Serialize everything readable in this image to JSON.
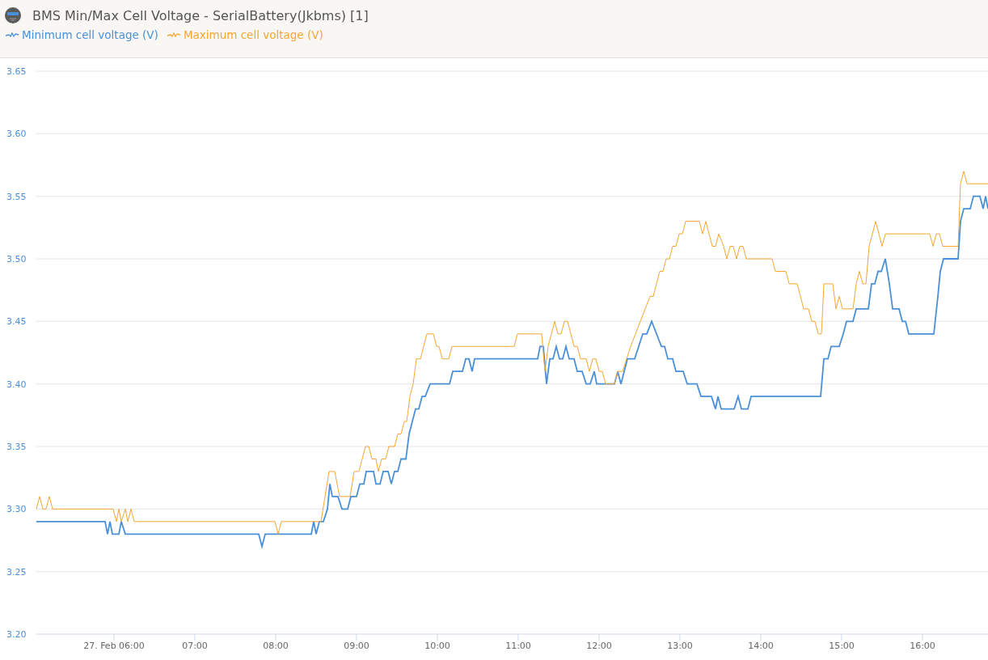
{
  "header": {
    "title": "BMS Min/Max Cell Voltage - SerialBattery(Jkbms) [1]"
  },
  "chart_data": {
    "type": "line",
    "grid": true,
    "xlim": [
      5.04,
      16.81
    ],
    "ylim": [
      3.2,
      3.65
    ],
    "xticks": [
      {
        "value": 6,
        "label": "27. Feb 06:00"
      },
      {
        "value": 7,
        "label": "07:00"
      },
      {
        "value": 8,
        "label": "08:00"
      },
      {
        "value": 9,
        "label": "09:00"
      },
      {
        "value": 10,
        "label": "10:00"
      },
      {
        "value": 11,
        "label": "11:00"
      },
      {
        "value": 12,
        "label": "12:00"
      },
      {
        "value": 13,
        "label": "13:00"
      },
      {
        "value": 14,
        "label": "14:00"
      },
      {
        "value": 15,
        "label": "15:00"
      },
      {
        "value": 16,
        "label": "16:00"
      }
    ],
    "yticks": [
      {
        "value": 3.2,
        "label": "3.20"
      },
      {
        "value": 3.25,
        "label": "3.25"
      },
      {
        "value": 3.3,
        "label": "3.30"
      },
      {
        "value": 3.35,
        "label": "3.35"
      },
      {
        "value": 3.4,
        "label": "3.40"
      },
      {
        "value": 3.45,
        "label": "3.45"
      },
      {
        "value": 3.5,
        "label": "3.50"
      },
      {
        "value": 3.55,
        "label": "3.55"
      },
      {
        "value": 3.6,
        "label": "3.60"
      },
      {
        "value": 3.65,
        "label": "3.65"
      }
    ],
    "series": [
      {
        "name": "Minimum cell voltage (V)",
        "color": "#4a90d9",
        "x": [
          5.04,
          5.89,
          5.92,
          5.95,
          5.98,
          6.06,
          6.09,
          6.14,
          7.79,
          7.83,
          7.87,
          8.44,
          8.47,
          8.5,
          8.54,
          8.59,
          8.64,
          8.67,
          8.7,
          8.77,
          8.82,
          8.89,
          8.93,
          9.0,
          9.04,
          9.09,
          9.12,
          9.21,
          9.24,
          9.29,
          9.33,
          9.39,
          9.43,
          9.47,
          9.51,
          9.55,
          9.61,
          9.65,
          9.69,
          9.73,
          9.77,
          9.81,
          9.85,
          9.91,
          10.15,
          10.19,
          10.31,
          10.35,
          10.39,
          10.43,
          10.46,
          11.24,
          11.27,
          11.31,
          11.35,
          11.39,
          11.43,
          11.47,
          11.51,
          11.55,
          11.59,
          11.63,
          11.69,
          11.73,
          11.79,
          11.84,
          11.89,
          11.94,
          11.97,
          12.19,
          12.23,
          12.27,
          12.31,
          12.35,
          12.44,
          12.49,
          12.54,
          12.59,
          12.65,
          12.71,
          12.77,
          12.81,
          12.85,
          12.91,
          12.95,
          13.04,
          13.09,
          13.21,
          13.26,
          13.39,
          13.44,
          13.47,
          13.51,
          13.67,
          13.72,
          13.76,
          13.84,
          13.88,
          14.74,
          14.78,
          14.83,
          14.87,
          14.97,
          15.02,
          15.06,
          15.14,
          15.18,
          15.33,
          15.37,
          15.41,
          15.45,
          15.49,
          15.54,
          15.59,
          15.63,
          15.71,
          15.75,
          15.79,
          15.83,
          16.14,
          16.19,
          16.22,
          16.26,
          16.44,
          16.47,
          16.51,
          16.59,
          16.63,
          16.71,
          16.75,
          16.78,
          16.81
        ],
        "values": [
          3.29,
          3.29,
          3.28,
          3.29,
          3.28,
          3.28,
          3.29,
          3.28,
          3.28,
          3.27,
          3.28,
          3.28,
          3.29,
          3.28,
          3.29,
          3.29,
          3.3,
          3.32,
          3.31,
          3.31,
          3.3,
          3.3,
          3.31,
          3.31,
          3.32,
          3.32,
          3.33,
          3.33,
          3.32,
          3.32,
          3.33,
          3.33,
          3.32,
          3.33,
          3.33,
          3.34,
          3.34,
          3.36,
          3.37,
          3.38,
          3.38,
          3.39,
          3.39,
          3.4,
          3.4,
          3.41,
          3.41,
          3.42,
          3.42,
          3.41,
          3.42,
          3.42,
          3.43,
          3.43,
          3.4,
          3.42,
          3.42,
          3.43,
          3.42,
          3.42,
          3.43,
          3.42,
          3.42,
          3.41,
          3.41,
          3.4,
          3.4,
          3.41,
          3.4,
          3.4,
          3.41,
          3.4,
          3.41,
          3.42,
          3.42,
          3.43,
          3.44,
          3.44,
          3.45,
          3.44,
          3.43,
          3.43,
          3.42,
          3.42,
          3.41,
          3.41,
          3.4,
          3.4,
          3.39,
          3.39,
          3.38,
          3.39,
          3.38,
          3.38,
          3.39,
          3.38,
          3.38,
          3.39,
          3.39,
          3.42,
          3.42,
          3.43,
          3.43,
          3.44,
          3.45,
          3.45,
          3.46,
          3.46,
          3.48,
          3.48,
          3.49,
          3.49,
          3.5,
          3.48,
          3.46,
          3.46,
          3.45,
          3.45,
          3.44,
          3.44,
          3.47,
          3.49,
          3.5,
          3.5,
          3.53,
          3.54,
          3.54,
          3.55,
          3.55,
          3.54,
          3.55,
          3.54
        ]
      },
      {
        "name": "Maximum cell voltage (V)",
        "color": "#f5a632",
        "x": [
          5.04,
          5.08,
          5.12,
          5.16,
          5.2,
          5.24,
          5.99,
          6.03,
          6.06,
          6.09,
          6.14,
          6.17,
          6.21,
          6.25,
          7.99,
          8.03,
          8.07,
          8.56,
          8.61,
          8.66,
          8.73,
          8.79,
          8.92,
          8.97,
          9.03,
          9.07,
          9.11,
          9.15,
          9.19,
          9.24,
          9.27,
          9.31,
          9.36,
          9.4,
          9.47,
          9.51,
          9.55,
          9.59,
          9.62,
          9.66,
          9.7,
          9.74,
          9.79,
          9.83,
          9.87,
          9.95,
          9.99,
          10.02,
          10.06,
          10.14,
          10.18,
          10.95,
          10.99,
          11.29,
          11.33,
          11.37,
          11.41,
          11.45,
          11.49,
          11.53,
          11.57,
          11.61,
          11.65,
          11.69,
          11.73,
          11.77,
          11.84,
          11.88,
          11.92,
          11.96,
          12.0,
          12.04,
          12.08,
          12.19,
          12.23,
          12.29,
          12.34,
          12.39,
          12.45,
          12.51,
          12.57,
          12.63,
          12.67,
          12.71,
          12.75,
          12.79,
          12.83,
          12.87,
          12.91,
          12.95,
          12.99,
          13.03,
          13.07,
          13.24,
          13.28,
          13.32,
          13.36,
          13.4,
          13.44,
          13.48,
          13.54,
          13.58,
          13.62,
          13.66,
          13.7,
          13.74,
          13.78,
          13.82,
          14.14,
          14.18,
          14.31,
          14.35,
          14.45,
          14.49,
          14.53,
          14.59,
          14.63,
          14.67,
          14.71,
          14.75,
          14.78,
          14.89,
          14.93,
          14.97,
          15.01,
          15.14,
          15.18,
          15.22,
          15.26,
          15.3,
          15.34,
          15.38,
          15.42,
          15.46,
          15.5,
          15.54,
          16.09,
          16.13,
          16.17,
          16.21,
          16.25,
          16.44,
          16.47,
          16.51,
          16.55,
          16.81
        ],
        "values": [
          3.3,
          3.31,
          3.3,
          3.3,
          3.31,
          3.3,
          3.3,
          3.29,
          3.3,
          3.29,
          3.3,
          3.29,
          3.3,
          3.29,
          3.29,
          3.28,
          3.29,
          3.29,
          3.31,
          3.33,
          3.33,
          3.31,
          3.31,
          3.33,
          3.33,
          3.34,
          3.35,
          3.35,
          3.34,
          3.34,
          3.33,
          3.34,
          3.34,
          3.35,
          3.35,
          3.36,
          3.36,
          3.37,
          3.37,
          3.39,
          3.4,
          3.42,
          3.42,
          3.43,
          3.44,
          3.44,
          3.43,
          3.43,
          3.42,
          3.42,
          3.43,
          3.43,
          3.44,
          3.44,
          3.41,
          3.43,
          3.44,
          3.45,
          3.44,
          3.44,
          3.45,
          3.45,
          3.44,
          3.43,
          3.43,
          3.42,
          3.42,
          3.41,
          3.42,
          3.42,
          3.41,
          3.41,
          3.4,
          3.4,
          3.41,
          3.41,
          3.42,
          3.43,
          3.44,
          3.45,
          3.46,
          3.47,
          3.47,
          3.48,
          3.49,
          3.49,
          3.5,
          3.5,
          3.51,
          3.51,
          3.52,
          3.52,
          3.53,
          3.53,
          3.52,
          3.53,
          3.52,
          3.51,
          3.51,
          3.52,
          3.51,
          3.5,
          3.51,
          3.51,
          3.5,
          3.51,
          3.51,
          3.5,
          3.5,
          3.49,
          3.49,
          3.48,
          3.48,
          3.47,
          3.46,
          3.46,
          3.45,
          3.45,
          3.44,
          3.44,
          3.48,
          3.48,
          3.46,
          3.47,
          3.46,
          3.46,
          3.48,
          3.49,
          3.48,
          3.48,
          3.51,
          3.52,
          3.53,
          3.52,
          3.51,
          3.52,
          3.52,
          3.51,
          3.52,
          3.52,
          3.51,
          3.51,
          3.56,
          3.57,
          3.56,
          3.56
        ]
      }
    ]
  }
}
